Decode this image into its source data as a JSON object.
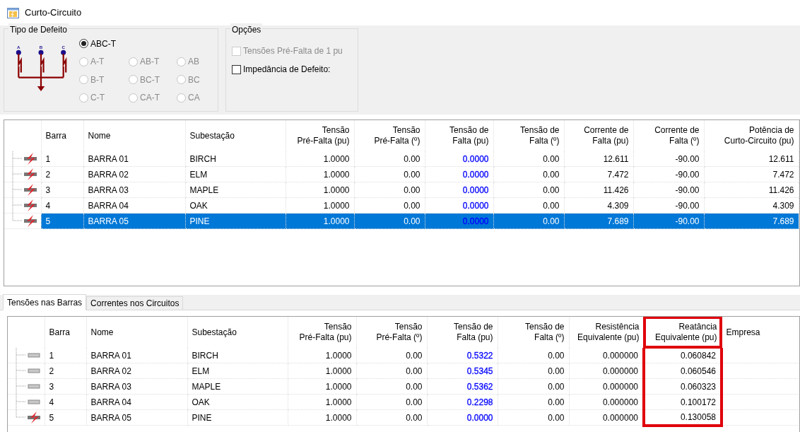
{
  "window": {
    "title": "Curto-Circuito"
  },
  "fault_type": {
    "title": "Tipo de Defeito",
    "phase_labels": [
      "A",
      "B",
      "C"
    ],
    "options": [
      {
        "label": "ABC-T",
        "selected": true,
        "disabled": false
      },
      {
        "label": "A-T",
        "selected": false,
        "disabled": true
      },
      {
        "label": "AB-T",
        "selected": false,
        "disabled": true
      },
      {
        "label": "AB",
        "selected": false,
        "disabled": true
      },
      {
        "label": "B-T",
        "selected": false,
        "disabled": true
      },
      {
        "label": "BC-T",
        "selected": false,
        "disabled": true
      },
      {
        "label": "BC",
        "selected": false,
        "disabled": true
      },
      {
        "label": "C-T",
        "selected": false,
        "disabled": true
      },
      {
        "label": "CA-T",
        "selected": false,
        "disabled": true
      },
      {
        "label": "CA",
        "selected": false,
        "disabled": true
      }
    ]
  },
  "options": {
    "title": "Opções",
    "checkboxes": [
      {
        "label": "Tensões Pré-Falta de 1 pu",
        "checked": false,
        "disabled": true
      },
      {
        "label": "Impedância de Defeito:",
        "checked": false,
        "disabled": false
      }
    ]
  },
  "results_table": {
    "columns": [
      {},
      {
        "label": "Barra"
      },
      {
        "label": "Nome"
      },
      {
        "label": "Subestação"
      },
      {
        "label": "Tensão\nPré-Falta (pu)"
      },
      {
        "label": "Tensão\nPré-Falta (º)"
      },
      {
        "label": "Tensão de\nFalta (pu)",
        "color": "#0000ff"
      },
      {
        "label": "Tensão de\nFalta (º)"
      },
      {
        "label": "Corrente de\nFalta (pu)"
      },
      {
        "label": "Corrente de\nFalta (º)"
      },
      {
        "label": "Potência de\nCurto-Circuito (pu)"
      }
    ],
    "rows": [
      {
        "kind": "fault",
        "selected": false,
        "cells": [
          "",
          "1",
          "BARRA 01",
          "BIRCH",
          "1.0000",
          "0.00",
          "0.0000",
          "0.00",
          "12.611",
          "-90.00",
          "12.611"
        ]
      },
      {
        "kind": "fault",
        "selected": false,
        "cells": [
          "",
          "2",
          "BARRA 02",
          "ELM",
          "1.0000",
          "0.00",
          "0.0000",
          "0.00",
          "7.472",
          "-90.00",
          "7.472"
        ]
      },
      {
        "kind": "fault",
        "selected": false,
        "cells": [
          "",
          "3",
          "BARRA 03",
          "MAPLE",
          "1.0000",
          "0.00",
          "0.0000",
          "0.00",
          "11.426",
          "-90.00",
          "11.426"
        ]
      },
      {
        "kind": "fault",
        "selected": false,
        "cells": [
          "",
          "4",
          "BARRA 04",
          "OAK",
          "1.0000",
          "0.00",
          "0.0000",
          "0.00",
          "4.309",
          "-90.00",
          "4.309"
        ]
      },
      {
        "kind": "fault",
        "selected": true,
        "cells": [
          "",
          "5",
          "BARRA 05",
          "PINE",
          "1.0000",
          "0.00",
          "0.0000",
          "0.00",
          "7.689",
          "-90.00",
          "7.689"
        ]
      }
    ]
  },
  "tabs": [
    {
      "label": "Tensões nas Barras",
      "selected": true
    },
    {
      "label": "Correntes nos Circuitos",
      "selected": false
    }
  ],
  "bus_table": {
    "columns": [
      {},
      {
        "label": "Barra"
      },
      {
        "label": "Nome"
      },
      {
        "label": "Subestação"
      },
      {
        "label": "Tensão\nPré-Falta (pu)"
      },
      {
        "label": "Tensão\nPré-Falta (º)"
      },
      {
        "label": "Tensão de\nFalta (pu)",
        "color": "#0000ff"
      },
      {
        "label": "Tensão de\nFalta (º)"
      },
      {
        "label": "Resistência\nEquivalente (pu)"
      },
      {
        "label": "Reatância\nEquivalente (pu)",
        "highlighted": true
      },
      {
        "label": "Empresa"
      }
    ],
    "rows": [
      {
        "kind": "bus",
        "selected": false,
        "cells": [
          "",
          "1",
          "BARRA 01",
          "BIRCH",
          "1.0000",
          "0.00",
          "0.5322",
          "0.00",
          "0.000000",
          "0.060842",
          ""
        ]
      },
      {
        "kind": "bus",
        "selected": false,
        "cells": [
          "",
          "2",
          "BARRA 02",
          "ELM",
          "1.0000",
          "0.00",
          "0.5345",
          "0.00",
          "0.000000",
          "0.060546",
          ""
        ]
      },
      {
        "kind": "bus",
        "selected": false,
        "cells": [
          "",
          "3",
          "BARRA 03",
          "MAPLE",
          "1.0000",
          "0.00",
          "0.5362",
          "0.00",
          "0.000000",
          "0.060323",
          ""
        ]
      },
      {
        "kind": "bus",
        "selected": false,
        "cells": [
          "",
          "4",
          "BARRA 04",
          "OAK",
          "1.0000",
          "0.00",
          "0.2298",
          "0.00",
          "0.000000",
          "0.100172",
          ""
        ]
      },
      {
        "kind": "fault",
        "selected": false,
        "cells": [
          "",
          "5",
          "BARRA 05",
          "PINE",
          "1.0000",
          "0.00",
          "0.0000",
          "0.00",
          "0.000000",
          "0.130058",
          ""
        ]
      }
    ]
  }
}
